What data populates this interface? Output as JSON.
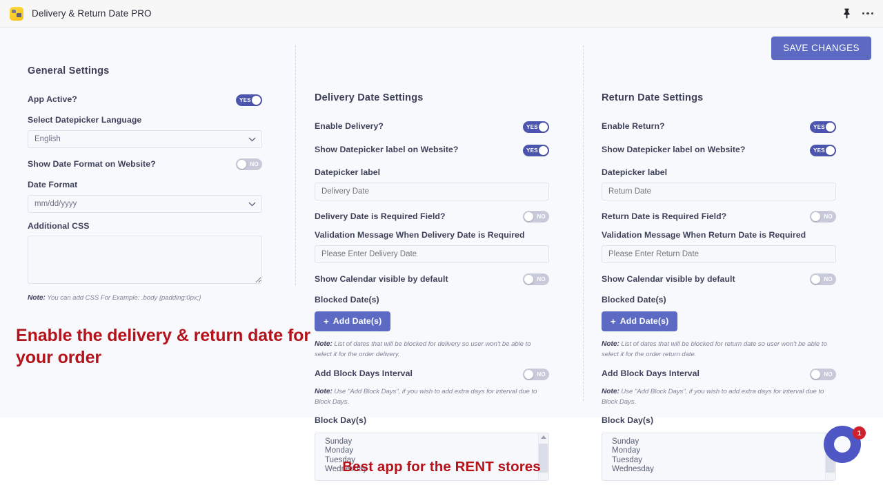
{
  "chrome": {
    "app_title": "Delivery & Return Date PRO",
    "pin_icon": "pin-icon",
    "menu_icon": "more-options-icon"
  },
  "toolbar": {
    "save_label": "SAVE CHANGES"
  },
  "general": {
    "title": "General Settings",
    "app_active_label": "App Active?",
    "app_active_value": "YES",
    "language_label": "Select Datepicker Language",
    "language_value": "English",
    "show_date_format_label": "Show Date Format on Website?",
    "show_date_format_value": "NO",
    "date_format_label": "Date Format",
    "date_format_value": "mm/dd/yyyy",
    "additional_css_label": "Additional CSS",
    "additional_css_value": "",
    "css_note_prefix": "Note:",
    "css_note": "You can add CSS For Example: .body {padding:0px;}"
  },
  "delivery": {
    "title": "Delivery Date Settings",
    "enable_label": "Enable Delivery?",
    "enable_value": "YES",
    "show_label_label": "Show Datepicker label on Website?",
    "show_label_value": "YES",
    "datepicker_label_label": "Datepicker label",
    "datepicker_label_placeholder": "Delivery Date",
    "required_label": "Delivery Date is Required Field?",
    "required_value": "NO",
    "validation_label": "Validation Message When Delivery Date is Required",
    "validation_placeholder": "Please Enter Delivery Date",
    "show_calendar_label": "Show Calendar visible by default",
    "show_calendar_value": "NO",
    "blocked_dates_label": "Blocked Date(s)",
    "add_dates_label": "Add Date(s)",
    "blocked_note_prefix": "Note:",
    "blocked_note": "List of dates that will be blocked for delivery so user won't be able to select it for the order delivery.",
    "block_interval_label": "Add Block Days Interval",
    "block_interval_value": "NO",
    "interval_note_prefix": "Note:",
    "interval_note": "Use \"Add Block Days\", if you wish to add extra days for interval due to Block Days.",
    "block_days_label": "Block Day(s)",
    "block_days_options": [
      "Sunday",
      "Monday",
      "Tuesday",
      "Wednesday"
    ]
  },
  "return": {
    "title": "Return Date Settings",
    "enable_label": "Enable Return?",
    "enable_value": "YES",
    "show_label_label": "Show Datepicker label on Website?",
    "show_label_value": "YES",
    "datepicker_label_label": "Datepicker label",
    "datepicker_label_placeholder": "Return Date",
    "required_label": "Return Date is Required Field?",
    "required_value": "NO",
    "validation_label": "Validation Message When Return Date is Required",
    "validation_placeholder": "Please Enter Return Date",
    "show_calendar_label": "Show Calendar visible by default",
    "show_calendar_value": "NO",
    "blocked_dates_label": "Blocked Date(s)",
    "add_dates_label": "Add Date(s)",
    "blocked_note_prefix": "Note:",
    "blocked_note": "List of dates that will be blocked for return date so user won't be able to select it for the order return date.",
    "block_interval_label": "Add Block Days Interval",
    "block_interval_value": "NO",
    "interval_note_prefix": "Note:",
    "interval_note": "Use \"Add Block Days\", if you wish to add extra days for interval due to Block Days.",
    "block_days_label": "Block Day(s)",
    "block_days_options": [
      "Sunday",
      "Monday",
      "Tuesday",
      "Wednesday"
    ]
  },
  "marketing": {
    "headline": "Enable the delivery & return date for your order",
    "tagline": "Best app for the RENT stores",
    "accent_color": "#b4131b"
  },
  "chat": {
    "badge_count": "1",
    "accent_color": "#4e57c4"
  },
  "colors": {
    "primary": "#5c6ac4",
    "toggle_on": "#4c55ad",
    "toggle_off": "#c7cad8",
    "panel_bg": "#f8f9fc",
    "text": "#3d4159"
  }
}
